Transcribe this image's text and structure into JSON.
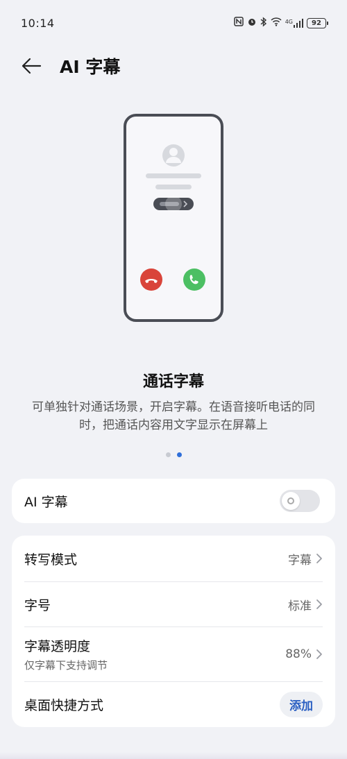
{
  "status": {
    "time": "10:14",
    "signal_label": "4G",
    "battery": "92"
  },
  "header": {
    "title": "AI 字幕"
  },
  "intro": {
    "title": "通话字幕",
    "description": "可单独针对通话场景，开启字幕。在语音接听电话的同时，把通话内容用文字显示在屏幕上",
    "pager": {
      "count": 2,
      "active_index": 1
    }
  },
  "toggle_card": {
    "label": "AI 字幕",
    "enabled": false
  },
  "settings": {
    "transcribe_mode": {
      "label": "转写模式",
      "value": "字幕"
    },
    "font_size": {
      "label": "字号",
      "value": "标准"
    },
    "opacity": {
      "label": "字幕透明度",
      "sub": "仅字幕下支持调节",
      "value": "88%"
    },
    "shortcut": {
      "label": "桌面快捷方式",
      "button": "添加"
    }
  },
  "colors": {
    "accent": "#2f6fd9",
    "decline": "#d9443a",
    "accept": "#4cbf63"
  }
}
